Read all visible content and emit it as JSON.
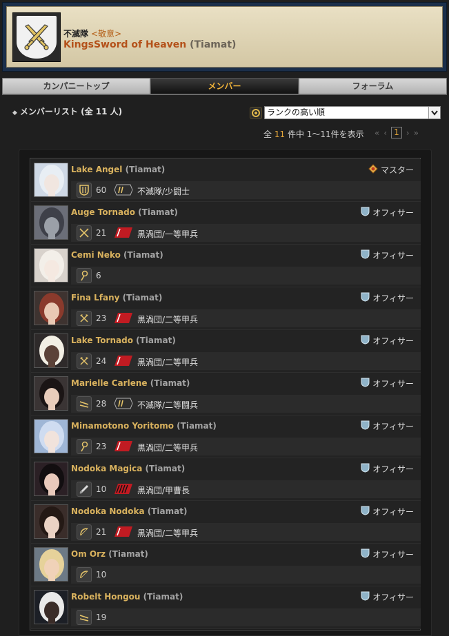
{
  "company": {
    "tag": "不滅隊",
    "rank_tag": "<敬意>",
    "name": "KingsSword of Heaven",
    "world": "(Tiamat)"
  },
  "tabs": [
    {
      "label": "カンパニートップ",
      "active": false
    },
    {
      "label": "メンバー",
      "active": true
    },
    {
      "label": "フォーラム",
      "active": false
    }
  ],
  "list": {
    "title": "メンバーリスト (全 11 人)",
    "sort_selected": "ランクの高い順",
    "count_prefix": "全",
    "count_total": "11",
    "count_suffix": "件中 1〜11件を表示",
    "pager_current": "1"
  },
  "members": [
    {
      "name": "Lake Angel",
      "world": "(Tiamat)",
      "role": "マスター",
      "role_icon": "crown-icon",
      "job_icon": "shield-icon",
      "level": "60",
      "gc": "immortal",
      "gc_rank": "不滅隊/少闘士",
      "portrait_bg": "#cfd9e6",
      "hair": "#e8eef4",
      "skin": "#f1e6e0"
    },
    {
      "name": "Auge Tornado",
      "world": "(Tiamat)",
      "role": "オフィサー",
      "role_icon": "officer-icon",
      "job_icon": "swords-icon",
      "level": "21",
      "gc": "maelstrom",
      "gc_rank": "黒渦団/一等甲兵",
      "portrait_bg": "#6b6e78",
      "hair": "#3e4049",
      "skin": "#9ba0a8"
    },
    {
      "name": "Cemi Neko",
      "world": "(Tiamat)",
      "role": "オフィサー",
      "role_icon": "officer-icon",
      "job_icon": "staff-icon",
      "level": "6",
      "gc": "",
      "gc_rank": "",
      "portrait_bg": "#d8d2cc",
      "hair": "#f3efe9",
      "skin": "#f5e9e1"
    },
    {
      "name": "Fina Lfany",
      "world": "(Tiamat)",
      "role": "オフィサー",
      "role_icon": "officer-icon",
      "job_icon": "axe-icon",
      "level": "23",
      "gc": "maelstrom",
      "gc_rank": "黒渦団/二等甲兵",
      "portrait_bg": "#3e3330",
      "hair": "#8a3a2c",
      "skin": "#e9c9b4"
    },
    {
      "name": "Lake Tornado",
      "world": "(Tiamat)",
      "role": "オフィサー",
      "role_icon": "officer-icon",
      "job_icon": "axe-icon",
      "level": "24",
      "gc": "maelstrom",
      "gc_rank": "黒渦団/二等甲兵",
      "portrait_bg": "#2e2a2a",
      "hair": "#f2efe4",
      "skin": "#5b4238"
    },
    {
      "name": "Marielle Carlene",
      "world": "(Tiamat)",
      "role": "オフィサー",
      "role_icon": "officer-icon",
      "job_icon": "dagger-icon",
      "level": "28",
      "gc": "immortal",
      "gc_rank": "不滅隊/二等闘兵",
      "portrait_bg": "#3a3434",
      "hair": "#1b1515",
      "skin": "#e9cdbb"
    },
    {
      "name": "Minamotono Yoritomo",
      "world": "(Tiamat)",
      "role": "オフィサー",
      "role_icon": "officer-icon",
      "job_icon": "staff-icon",
      "level": "23",
      "gc": "maelstrom",
      "gc_rank": "黒渦団/二等甲兵",
      "portrait_bg": "#9fb6d6",
      "hair": "#cfdcf1",
      "skin": "#f1e3dc"
    },
    {
      "name": "Nodoka Magica",
      "world": "(Tiamat)",
      "role": "オフィサー",
      "role_icon": "officer-icon",
      "job_icon": "sword-icon",
      "level": "10",
      "gc": "maelstrom2",
      "gc_rank": "黒渦団/甲曹長",
      "portrait_bg": "#2b2025",
      "hair": "#120e10",
      "skin": "#e8c9bb"
    },
    {
      "name": "Nodoka Nodoka",
      "world": "(Tiamat)",
      "role": "オフィサー",
      "role_icon": "officer-icon",
      "job_icon": "bow-icon",
      "level": "21",
      "gc": "maelstrom",
      "gc_rank": "黒渦団/二等甲兵",
      "portrait_bg": "#3a2d2a",
      "hair": "#241915",
      "skin": "#ead2c4"
    },
    {
      "name": "Om Orz",
      "world": "(Tiamat)",
      "role": "オフィサー",
      "role_icon": "officer-icon",
      "job_icon": "bow-icon",
      "level": "10",
      "gc": "",
      "gc_rank": "",
      "portrait_bg": "#6d7a86",
      "hair": "#e6d29a",
      "skin": "#f0d2b8"
    },
    {
      "name": "Robelt Hongou",
      "world": "(Tiamat)",
      "role": "オフィサー",
      "role_icon": "officer-icon",
      "job_icon": "dagger-icon",
      "level": "19",
      "gc": "",
      "gc_rank": "",
      "portrait_bg": "#1c1f26",
      "hair": "#e9e9e9",
      "skin": "#3a2c28"
    }
  ]
}
